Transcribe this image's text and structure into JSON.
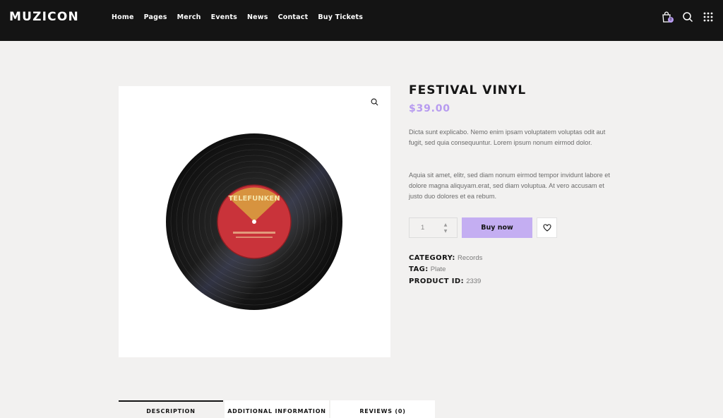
{
  "header": {
    "logo": "MUZICON",
    "nav": [
      "Home",
      "Pages",
      "Merch",
      "Events",
      "News",
      "Contact",
      "Buy Tickets"
    ],
    "cart_count": "0",
    "icons": [
      "shopping-bag-icon",
      "search-icon",
      "grid-menu-icon"
    ]
  },
  "product": {
    "title": "FESTIVAL VINYL",
    "price": "$39.00",
    "desc1": "Dicta sunt explicabo. Nemo enim ipsam voluptatem voluptas odit aut fugit, sed quia consequuntur. Lorem ipsum nonum eirmod dolor.",
    "desc2": "Aquia sit amet, elitr, sed diam nonum eirmod tempor invidunt labore et dolore magna aliquyam.erat, sed diam voluptua. At vero accusam et justo duo dolores et ea rebum.",
    "quantity": "1",
    "buy_label": "Buy now",
    "label_text": "TELEFUNKEN",
    "meta": {
      "category_key": "CATEGORY:",
      "category_val": "Records",
      "tag_key": "TAG:",
      "tag_val": "Plate",
      "id_key": "PRODUCT ID:",
      "id_val": "2339"
    }
  },
  "tabs": [
    "DESCRIPTION",
    "ADDITIONAL INFORMATION",
    "REVIEWS (0)"
  ],
  "colors": {
    "accent": "#b79bf0",
    "button": "#c4aef2",
    "header_bg": "#141414",
    "label_red": "#c9333a"
  }
}
